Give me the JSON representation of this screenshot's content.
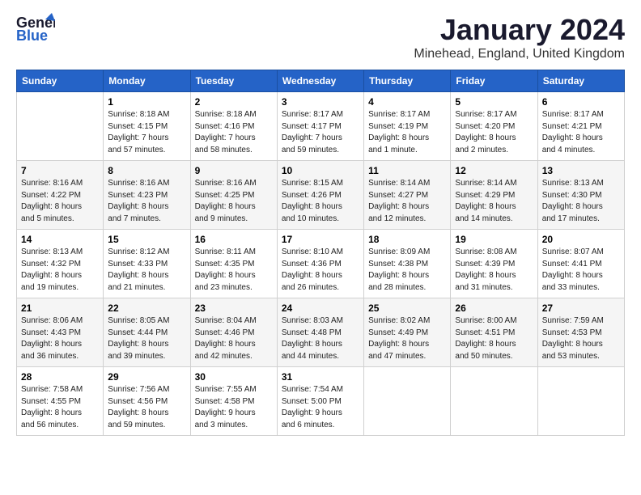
{
  "header": {
    "logo_line1": "General",
    "logo_line2": "Blue",
    "title": "January 2024",
    "subtitle": "Minehead, England, United Kingdom"
  },
  "days_of_week": [
    "Sunday",
    "Monday",
    "Tuesday",
    "Wednesday",
    "Thursday",
    "Friday",
    "Saturday"
  ],
  "weeks": [
    [
      {
        "day": "",
        "info": ""
      },
      {
        "day": "1",
        "info": "Sunrise: 8:18 AM\nSunset: 4:15 PM\nDaylight: 7 hours\nand 57 minutes."
      },
      {
        "day": "2",
        "info": "Sunrise: 8:18 AM\nSunset: 4:16 PM\nDaylight: 7 hours\nand 58 minutes."
      },
      {
        "day": "3",
        "info": "Sunrise: 8:17 AM\nSunset: 4:17 PM\nDaylight: 7 hours\nand 59 minutes."
      },
      {
        "day": "4",
        "info": "Sunrise: 8:17 AM\nSunset: 4:19 PM\nDaylight: 8 hours\nand 1 minute."
      },
      {
        "day": "5",
        "info": "Sunrise: 8:17 AM\nSunset: 4:20 PM\nDaylight: 8 hours\nand 2 minutes."
      },
      {
        "day": "6",
        "info": "Sunrise: 8:17 AM\nSunset: 4:21 PM\nDaylight: 8 hours\nand 4 minutes."
      }
    ],
    [
      {
        "day": "7",
        "info": "Sunrise: 8:16 AM\nSunset: 4:22 PM\nDaylight: 8 hours\nand 5 minutes."
      },
      {
        "day": "8",
        "info": "Sunrise: 8:16 AM\nSunset: 4:23 PM\nDaylight: 8 hours\nand 7 minutes."
      },
      {
        "day": "9",
        "info": "Sunrise: 8:16 AM\nSunset: 4:25 PM\nDaylight: 8 hours\nand 9 minutes."
      },
      {
        "day": "10",
        "info": "Sunrise: 8:15 AM\nSunset: 4:26 PM\nDaylight: 8 hours\nand 10 minutes."
      },
      {
        "day": "11",
        "info": "Sunrise: 8:14 AM\nSunset: 4:27 PM\nDaylight: 8 hours\nand 12 minutes."
      },
      {
        "day": "12",
        "info": "Sunrise: 8:14 AM\nSunset: 4:29 PM\nDaylight: 8 hours\nand 14 minutes."
      },
      {
        "day": "13",
        "info": "Sunrise: 8:13 AM\nSunset: 4:30 PM\nDaylight: 8 hours\nand 17 minutes."
      }
    ],
    [
      {
        "day": "14",
        "info": "Sunrise: 8:13 AM\nSunset: 4:32 PM\nDaylight: 8 hours\nand 19 minutes."
      },
      {
        "day": "15",
        "info": "Sunrise: 8:12 AM\nSunset: 4:33 PM\nDaylight: 8 hours\nand 21 minutes."
      },
      {
        "day": "16",
        "info": "Sunrise: 8:11 AM\nSunset: 4:35 PM\nDaylight: 8 hours\nand 23 minutes."
      },
      {
        "day": "17",
        "info": "Sunrise: 8:10 AM\nSunset: 4:36 PM\nDaylight: 8 hours\nand 26 minutes."
      },
      {
        "day": "18",
        "info": "Sunrise: 8:09 AM\nSunset: 4:38 PM\nDaylight: 8 hours\nand 28 minutes."
      },
      {
        "day": "19",
        "info": "Sunrise: 8:08 AM\nSunset: 4:39 PM\nDaylight: 8 hours\nand 31 minutes."
      },
      {
        "day": "20",
        "info": "Sunrise: 8:07 AM\nSunset: 4:41 PM\nDaylight: 8 hours\nand 33 minutes."
      }
    ],
    [
      {
        "day": "21",
        "info": "Sunrise: 8:06 AM\nSunset: 4:43 PM\nDaylight: 8 hours\nand 36 minutes."
      },
      {
        "day": "22",
        "info": "Sunrise: 8:05 AM\nSunset: 4:44 PM\nDaylight: 8 hours\nand 39 minutes."
      },
      {
        "day": "23",
        "info": "Sunrise: 8:04 AM\nSunset: 4:46 PM\nDaylight: 8 hours\nand 42 minutes."
      },
      {
        "day": "24",
        "info": "Sunrise: 8:03 AM\nSunset: 4:48 PM\nDaylight: 8 hours\nand 44 minutes."
      },
      {
        "day": "25",
        "info": "Sunrise: 8:02 AM\nSunset: 4:49 PM\nDaylight: 8 hours\nand 47 minutes."
      },
      {
        "day": "26",
        "info": "Sunrise: 8:00 AM\nSunset: 4:51 PM\nDaylight: 8 hours\nand 50 minutes."
      },
      {
        "day": "27",
        "info": "Sunrise: 7:59 AM\nSunset: 4:53 PM\nDaylight: 8 hours\nand 53 minutes."
      }
    ],
    [
      {
        "day": "28",
        "info": "Sunrise: 7:58 AM\nSunset: 4:55 PM\nDaylight: 8 hours\nand 56 minutes."
      },
      {
        "day": "29",
        "info": "Sunrise: 7:56 AM\nSunset: 4:56 PM\nDaylight: 8 hours\nand 59 minutes."
      },
      {
        "day": "30",
        "info": "Sunrise: 7:55 AM\nSunset: 4:58 PM\nDaylight: 9 hours\nand 3 minutes."
      },
      {
        "day": "31",
        "info": "Sunrise: 7:54 AM\nSunset: 5:00 PM\nDaylight: 9 hours\nand 6 minutes."
      },
      {
        "day": "",
        "info": ""
      },
      {
        "day": "",
        "info": ""
      },
      {
        "day": "",
        "info": ""
      }
    ]
  ]
}
